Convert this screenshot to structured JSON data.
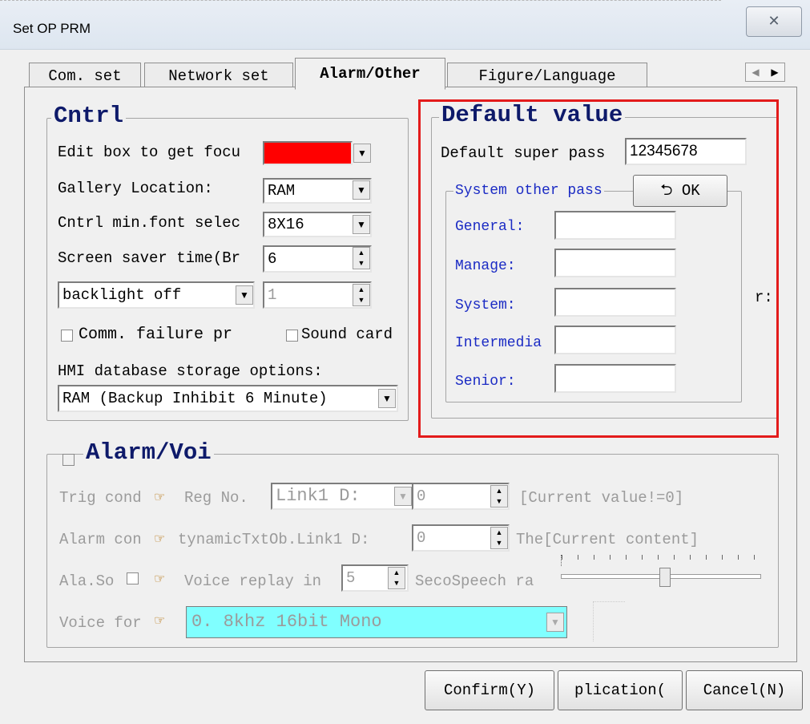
{
  "window": {
    "title": "Set OP PRM",
    "close_glyph": "✕"
  },
  "tabs": [
    "Com. set",
    "Network set",
    "Alarm/Other",
    "Figure/Language"
  ],
  "active_tab": 2,
  "cntrl": {
    "title": "Cntrl",
    "edit_focus_label": "Edit box to get focu",
    "edit_focus_color": "#ff0000",
    "gallery_label": "Gallery Location:",
    "gallery_value": "RAM",
    "font_label": "Cntrl min.font selec",
    "font_value": "8X16",
    "saver_label": "Screen saver time(Br",
    "saver_value": "6",
    "backlight_value": "backlight off",
    "backlight_num": "1",
    "comm_failure_label": "Comm. failure pr",
    "sound_card_label": "Sound card",
    "hmi_db_label": "HMI database storage options:",
    "hmi_db_value": "RAM (Backup Inhibit 6 Minute)"
  },
  "default_value": {
    "title": "Default value",
    "super_pass_label": "Default super pass",
    "super_pass_value": "12345678",
    "sys_other_title": "System other pass",
    "ok_label": "OK",
    "rows": [
      "General:",
      "Manage:",
      "System:",
      "Intermedia",
      "Senior:"
    ],
    "side_r_label": "r:"
  },
  "alarm": {
    "title": "Alarm/Voi",
    "trig_label": "Trig cond",
    "reg_label": "Reg No.",
    "link_value": "Link1 D:",
    "reg_value": "0",
    "cond_text": "[Current value!=0]",
    "alarm_con_label": "Alarm con",
    "dyn_text": "tynamicTxtOb.Link1 D:",
    "dyn_value": "0",
    "content_text": "The[Current content]",
    "ala_so_label": "Ala.So",
    "voice_replay_label": "Voice replay in",
    "voice_replay_value": "5",
    "seco_label": "SecoSpeech ra",
    "speech_rate_level": 0.52,
    "voice_for_label": "Voice for",
    "voice_value": "0. 8khz  16bit Mono"
  },
  "buttons": {
    "confirm": "Confirm(Y)",
    "application": "plication(",
    "cancel": "Cancel(N)"
  }
}
